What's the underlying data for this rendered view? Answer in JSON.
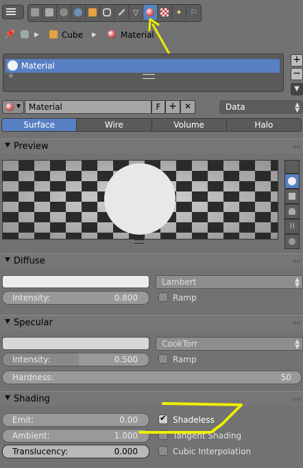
{
  "properties_tabs": {
    "icons": [
      "render-icon",
      "render-layers-icon",
      "scene-icon",
      "world-icon",
      "object-icon",
      "constraints-icon",
      "modifier-icon",
      "object-data-icon",
      "material-icon",
      "texture-icon",
      "particles-icon",
      "physics-icon"
    ],
    "active": "material-icon"
  },
  "breadcrumb": {
    "object": "Cube",
    "material": "Material"
  },
  "material_slots": {
    "items": [
      "Material"
    ]
  },
  "datablock": {
    "name": "Material",
    "fake_user": "F",
    "link": "Data"
  },
  "type_tabs": [
    "Surface",
    "Wire",
    "Volume",
    "Halo"
  ],
  "active_type": "Surface",
  "preview": {
    "title": "Preview"
  },
  "diffuse": {
    "title": "Diffuse",
    "shader": "Lambert",
    "intensity_label": "Intensity:",
    "intensity": "0.800",
    "ramp": "Ramp",
    "color": "#ececec"
  },
  "specular": {
    "title": "Specular",
    "shader": "CookTorr",
    "intensity_label": "Intensity:",
    "intensity": "0.500",
    "ramp": "Ramp",
    "hardness_label": "Hardness:",
    "hardness": "50",
    "color": "#d8d8d8"
  },
  "shading": {
    "title": "Shading",
    "emit_label": "Emit:",
    "emit": "0.00",
    "ambient_label": "Ambient:",
    "ambient": "1.000",
    "translucency_label": "Translucency:",
    "translucency": "0.000",
    "shadeless": "Shadeless",
    "shadeless_checked": true,
    "tangent": "Tangent Shading",
    "cubic": "Cubic Interpolation"
  },
  "colors": {
    "accent": "#5680c2",
    "annotation": "#f0f000"
  }
}
